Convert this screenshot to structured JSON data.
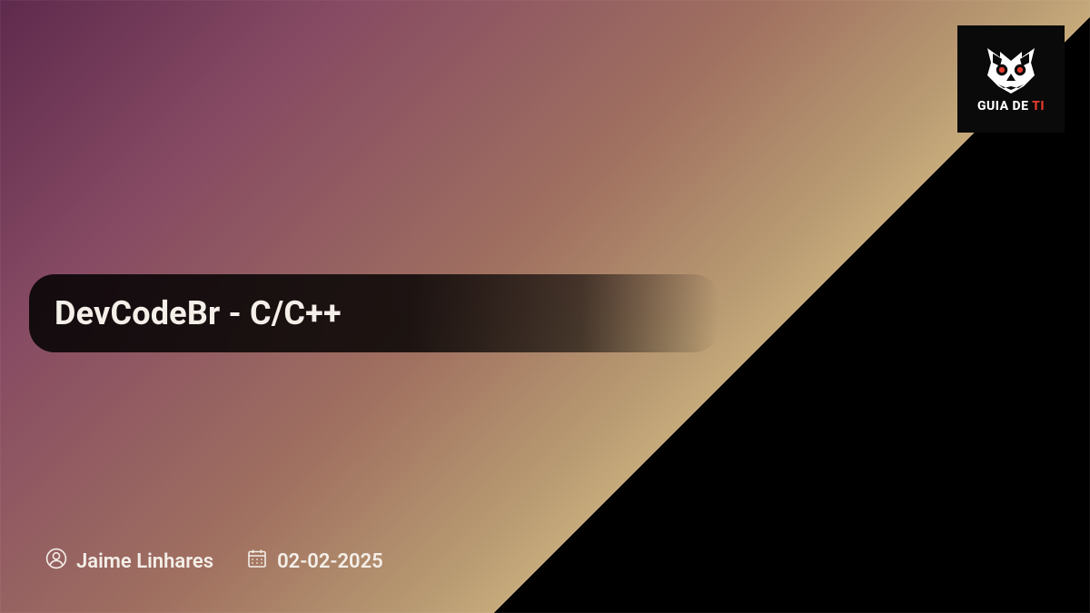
{
  "logo": {
    "text_prefix": "GUIA DE ",
    "text_accent": "TI"
  },
  "title": "DevCodeBr - C/C++",
  "author": "Jaime Linhares",
  "date": "02-02-2025"
}
